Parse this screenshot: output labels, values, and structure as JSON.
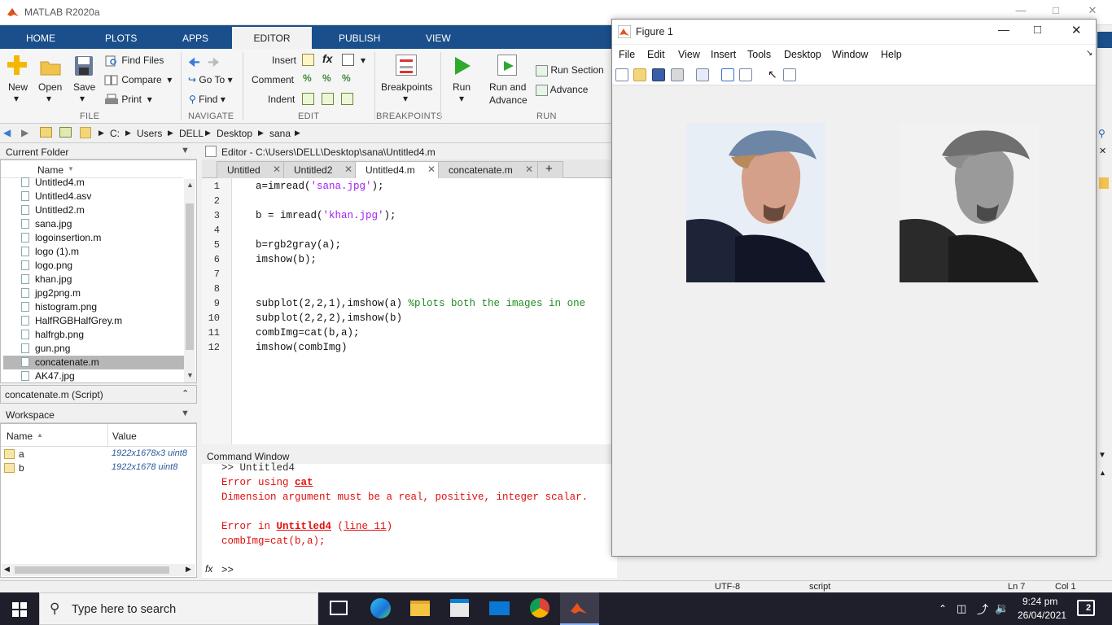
{
  "app": {
    "title": "MATLAB R2020a"
  },
  "tabs": [
    {
      "label": "HOME"
    },
    {
      "label": "PLOTS"
    },
    {
      "label": "APPS"
    },
    {
      "label": "EDITOR"
    },
    {
      "label": "PUBLISH"
    },
    {
      "label": "VIEW"
    }
  ],
  "ribbon": {
    "file": {
      "new": "New",
      "open": "Open",
      "save": "Save",
      "find_files": "Find Files",
      "compare": "Compare",
      "print": "Print",
      "group": "FILE"
    },
    "navigate": {
      "go_to": "Go To",
      "find": "Find",
      "group": "NAVIGATE"
    },
    "edit": {
      "insert": "Insert",
      "comment": "Comment",
      "indent": "Indent",
      "group": "EDIT"
    },
    "breakpoints": {
      "label": "Breakpoints",
      "group": "BREAKPOINTS"
    },
    "run": {
      "run": "Run",
      "run_and_advance_1": "Run and",
      "run_and_advance_2": "Advance",
      "run_section": "Run Section",
      "advance": "Advance",
      "group": "RUN"
    }
  },
  "address": {
    "path": [
      "C:",
      "Users",
      "DELL",
      "Desktop",
      "sana"
    ]
  },
  "current_folder": {
    "title": "Current Folder",
    "column": "Name",
    "files": [
      "Untitled4.m",
      "Untitled4.asv",
      "Untitled2.m",
      "sana.jpg",
      "logoinsertion.m",
      "logo (1).m",
      "logo.png",
      "khan.jpg",
      "jpg2png.m",
      "histogram.png",
      "HalfRGBHalfGrey.m",
      "halfrgb.png",
      "gun.png",
      "concatenate.m",
      "AK47.jpg"
    ],
    "selected": "concatenate.m"
  },
  "details": {
    "label": "concatenate.m  (Script)"
  },
  "workspace": {
    "title": "Workspace",
    "col_name": "Name",
    "col_value": "Value",
    "vars": [
      {
        "name": "a",
        "value": "1922x1678x3 uint8"
      },
      {
        "name": "b",
        "value": "1922x1678 uint8"
      }
    ]
  },
  "editor": {
    "title": "Editor - C:\\Users\\DELL\\Desktop\\sana\\Untitled4.m",
    "tabs": [
      "Untitled",
      "Untitled2",
      "Untitled4.m",
      "concatenate.m"
    ],
    "active_tab": "Untitled4.m",
    "line_numbers": [
      "1",
      "2",
      "3",
      "4",
      "5",
      "6",
      "7",
      "8",
      "9",
      "10",
      "11",
      "12"
    ],
    "code": {
      "l1a": "a=imread(",
      "l1s": "'sana.jpg'",
      "l1b": ");",
      "l3a": "b = imread(",
      "l3s": "'khan.jpg'",
      "l3b": ");",
      "l5": "b=rgb2gray(a);",
      "l6": "imshow(b);",
      "l9a": "subplot(2,2,1),imshow(a) ",
      "l9c": "%plots both the images in one",
      "l10": "subplot(2,2,2),imshow(b)",
      "l11": "combImg=cat(b,a);",
      "l12": "imshow(combImg)"
    }
  },
  "command_window": {
    "title": "Command Window",
    "line0": ">> Untitled4",
    "err1a": "Error using ",
    "err1b": "cat",
    "err2": "Dimension argument must be a real, positive, integer scalar.",
    "err3a": "Error in ",
    "err3b": "Untitled4",
    "err3c": " (",
    "err3d": "line 11",
    "err3e": ")",
    "err4": "combImg=cat(b,a);",
    "prompt": ">>",
    "fx": "fx"
  },
  "status_bar": {
    "encoding": "UTF-8",
    "type": "script",
    "ln": "Ln  7",
    "col": "Col  1"
  },
  "figure": {
    "title": "Figure 1",
    "menu": [
      "File",
      "Edit",
      "View",
      "Insert",
      "Tools",
      "Desktop",
      "Window",
      "Help"
    ]
  },
  "taskbar": {
    "search_placeholder": "Type here to search",
    "time": "9:24 pm",
    "date": "26/04/2021",
    "notifications": "2"
  },
  "colors": {
    "tab_bar": "#1a4f8b",
    "error": "#e01010",
    "string": "#a020f0",
    "comment": "#228b22"
  }
}
